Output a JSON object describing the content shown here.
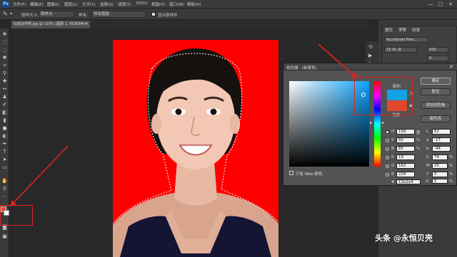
{
  "menubar": {
    "logo": "Ps",
    "items": [
      "文件(F)",
      "编辑(E)",
      "图像(I)",
      "图层(L)",
      "文字(Y)",
      "选择(S)",
      "滤镜(T)",
      "3D(D)",
      "视图(V)",
      "窗口(W)",
      "帮助(H)"
    ],
    "minimize": "—",
    "maximize": "□",
    "close": "✕"
  },
  "options": {
    "size_label": "取样大小:",
    "size_value": "取样点",
    "sample_label": "样本:",
    "sample_value": "所有图层",
    "ring_label": "显示取样环"
  },
  "document": {
    "tab_label": "红底证件照.jpg @ 119% (图层 1, RGB/8#) *",
    "close": "×"
  },
  "char_panel": {
    "tabs": [
      "属性",
      "字符",
      "段落"
    ],
    "font": "Accidental Pres...",
    "size": "15.41 点",
    "tracking": "0",
    "leading": "100"
  },
  "color_picker": {
    "title": "拾色器",
    "title_sub": "(前景色)",
    "new_label": "新的",
    "current_label": "当前",
    "ok": "确定",
    "cancel": "复位",
    "add_swatch": "添加到色板",
    "libraries": "颜色库",
    "web_only": "只有 Web 颜色",
    "fields": [
      {
        "name": "H",
        "value": "199",
        "unit": "度"
      },
      {
        "name": "S",
        "value": "92",
        "unit": "%"
      },
      {
        "name": "B",
        "value": "85",
        "unit": "%"
      },
      {
        "name": "R",
        "value": "19",
        "unit": ""
      },
      {
        "name": "G",
        "value": "162",
        "unit": ""
      },
      {
        "name": "B",
        "value": "228",
        "unit": ""
      }
    ],
    "lab": [
      {
        "name": "L",
        "value": "62"
      },
      {
        "name": "a",
        "value": "-17"
      },
      {
        "name": "b",
        "value": "-44"
      }
    ],
    "cmyk": [
      {
        "name": "C",
        "value": "74",
        "unit": "%"
      },
      {
        "name": "M",
        "value": "25",
        "unit": "%"
      },
      {
        "name": "Y",
        "value": "0",
        "unit": "%"
      },
      {
        "name": "K",
        "value": "0",
        "unit": "%"
      }
    ],
    "hex_label": "#",
    "hex": "13a2e4",
    "new_color": "#13a2e4",
    "current_color": "#e0472b"
  },
  "watermark": "头条 @永恒贝壳",
  "colors": {
    "canvas_bg": "#ff0000",
    "annotation": "#e0231f"
  }
}
